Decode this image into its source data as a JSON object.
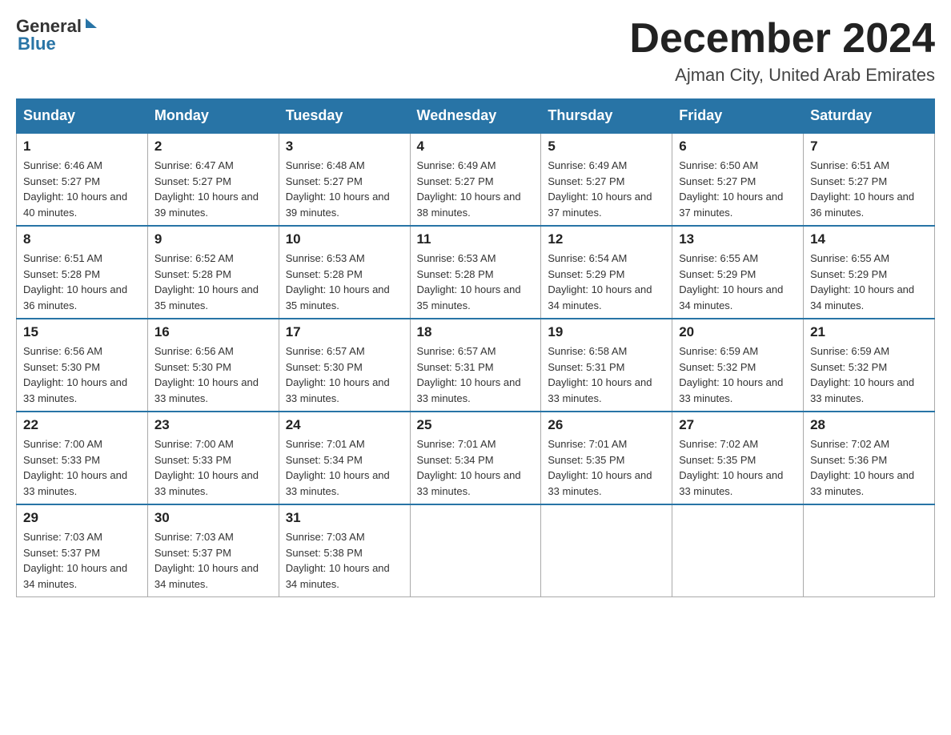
{
  "header": {
    "logo_general": "General",
    "logo_blue": "Blue",
    "month_title": "December 2024",
    "location": "Ajman City, United Arab Emirates"
  },
  "days_of_week": [
    "Sunday",
    "Monday",
    "Tuesday",
    "Wednesday",
    "Thursday",
    "Friday",
    "Saturday"
  ],
  "weeks": [
    [
      {
        "day": "1",
        "sunrise": "Sunrise: 6:46 AM",
        "sunset": "Sunset: 5:27 PM",
        "daylight": "Daylight: 10 hours and 40 minutes."
      },
      {
        "day": "2",
        "sunrise": "Sunrise: 6:47 AM",
        "sunset": "Sunset: 5:27 PM",
        "daylight": "Daylight: 10 hours and 39 minutes."
      },
      {
        "day": "3",
        "sunrise": "Sunrise: 6:48 AM",
        "sunset": "Sunset: 5:27 PM",
        "daylight": "Daylight: 10 hours and 39 minutes."
      },
      {
        "day": "4",
        "sunrise": "Sunrise: 6:49 AM",
        "sunset": "Sunset: 5:27 PM",
        "daylight": "Daylight: 10 hours and 38 minutes."
      },
      {
        "day": "5",
        "sunrise": "Sunrise: 6:49 AM",
        "sunset": "Sunset: 5:27 PM",
        "daylight": "Daylight: 10 hours and 37 minutes."
      },
      {
        "day": "6",
        "sunrise": "Sunrise: 6:50 AM",
        "sunset": "Sunset: 5:27 PM",
        "daylight": "Daylight: 10 hours and 37 minutes."
      },
      {
        "day": "7",
        "sunrise": "Sunrise: 6:51 AM",
        "sunset": "Sunset: 5:27 PM",
        "daylight": "Daylight: 10 hours and 36 minutes."
      }
    ],
    [
      {
        "day": "8",
        "sunrise": "Sunrise: 6:51 AM",
        "sunset": "Sunset: 5:28 PM",
        "daylight": "Daylight: 10 hours and 36 minutes."
      },
      {
        "day": "9",
        "sunrise": "Sunrise: 6:52 AM",
        "sunset": "Sunset: 5:28 PM",
        "daylight": "Daylight: 10 hours and 35 minutes."
      },
      {
        "day": "10",
        "sunrise": "Sunrise: 6:53 AM",
        "sunset": "Sunset: 5:28 PM",
        "daylight": "Daylight: 10 hours and 35 minutes."
      },
      {
        "day": "11",
        "sunrise": "Sunrise: 6:53 AM",
        "sunset": "Sunset: 5:28 PM",
        "daylight": "Daylight: 10 hours and 35 minutes."
      },
      {
        "day": "12",
        "sunrise": "Sunrise: 6:54 AM",
        "sunset": "Sunset: 5:29 PM",
        "daylight": "Daylight: 10 hours and 34 minutes."
      },
      {
        "day": "13",
        "sunrise": "Sunrise: 6:55 AM",
        "sunset": "Sunset: 5:29 PM",
        "daylight": "Daylight: 10 hours and 34 minutes."
      },
      {
        "day": "14",
        "sunrise": "Sunrise: 6:55 AM",
        "sunset": "Sunset: 5:29 PM",
        "daylight": "Daylight: 10 hours and 34 minutes."
      }
    ],
    [
      {
        "day": "15",
        "sunrise": "Sunrise: 6:56 AM",
        "sunset": "Sunset: 5:30 PM",
        "daylight": "Daylight: 10 hours and 33 minutes."
      },
      {
        "day": "16",
        "sunrise": "Sunrise: 6:56 AM",
        "sunset": "Sunset: 5:30 PM",
        "daylight": "Daylight: 10 hours and 33 minutes."
      },
      {
        "day": "17",
        "sunrise": "Sunrise: 6:57 AM",
        "sunset": "Sunset: 5:30 PM",
        "daylight": "Daylight: 10 hours and 33 minutes."
      },
      {
        "day": "18",
        "sunrise": "Sunrise: 6:57 AM",
        "sunset": "Sunset: 5:31 PM",
        "daylight": "Daylight: 10 hours and 33 minutes."
      },
      {
        "day": "19",
        "sunrise": "Sunrise: 6:58 AM",
        "sunset": "Sunset: 5:31 PM",
        "daylight": "Daylight: 10 hours and 33 minutes."
      },
      {
        "day": "20",
        "sunrise": "Sunrise: 6:59 AM",
        "sunset": "Sunset: 5:32 PM",
        "daylight": "Daylight: 10 hours and 33 minutes."
      },
      {
        "day": "21",
        "sunrise": "Sunrise: 6:59 AM",
        "sunset": "Sunset: 5:32 PM",
        "daylight": "Daylight: 10 hours and 33 minutes."
      }
    ],
    [
      {
        "day": "22",
        "sunrise": "Sunrise: 7:00 AM",
        "sunset": "Sunset: 5:33 PM",
        "daylight": "Daylight: 10 hours and 33 minutes."
      },
      {
        "day": "23",
        "sunrise": "Sunrise: 7:00 AM",
        "sunset": "Sunset: 5:33 PM",
        "daylight": "Daylight: 10 hours and 33 minutes."
      },
      {
        "day": "24",
        "sunrise": "Sunrise: 7:01 AM",
        "sunset": "Sunset: 5:34 PM",
        "daylight": "Daylight: 10 hours and 33 minutes."
      },
      {
        "day": "25",
        "sunrise": "Sunrise: 7:01 AM",
        "sunset": "Sunset: 5:34 PM",
        "daylight": "Daylight: 10 hours and 33 minutes."
      },
      {
        "day": "26",
        "sunrise": "Sunrise: 7:01 AM",
        "sunset": "Sunset: 5:35 PM",
        "daylight": "Daylight: 10 hours and 33 minutes."
      },
      {
        "day": "27",
        "sunrise": "Sunrise: 7:02 AM",
        "sunset": "Sunset: 5:35 PM",
        "daylight": "Daylight: 10 hours and 33 minutes."
      },
      {
        "day": "28",
        "sunrise": "Sunrise: 7:02 AM",
        "sunset": "Sunset: 5:36 PM",
        "daylight": "Daylight: 10 hours and 33 minutes."
      }
    ],
    [
      {
        "day": "29",
        "sunrise": "Sunrise: 7:03 AM",
        "sunset": "Sunset: 5:37 PM",
        "daylight": "Daylight: 10 hours and 34 minutes."
      },
      {
        "day": "30",
        "sunrise": "Sunrise: 7:03 AM",
        "sunset": "Sunset: 5:37 PM",
        "daylight": "Daylight: 10 hours and 34 minutes."
      },
      {
        "day": "31",
        "sunrise": "Sunrise: 7:03 AM",
        "sunset": "Sunset: 5:38 PM",
        "daylight": "Daylight: 10 hours and 34 minutes."
      },
      null,
      null,
      null,
      null
    ]
  ]
}
